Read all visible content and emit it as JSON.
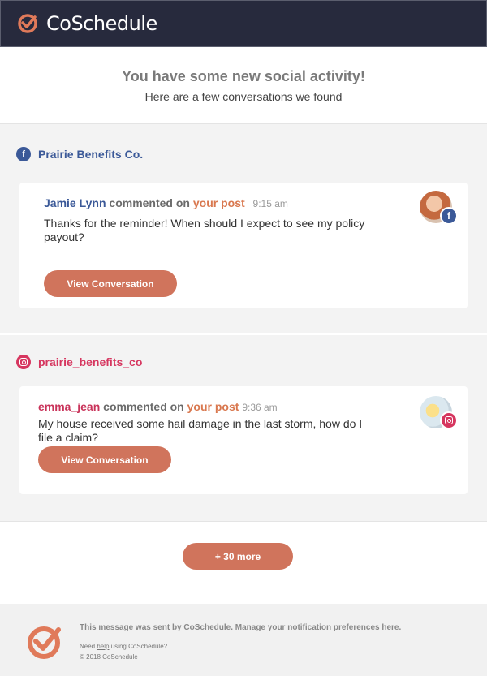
{
  "header": {
    "brand": "CoSchedule"
  },
  "intro": {
    "title": "You have some new social activity!",
    "subtitle": "Here are a few conversations we found"
  },
  "groups": [
    {
      "network": "facebook",
      "account": "Prairie Benefits Co.",
      "activity": {
        "user": "Jamie Lynn",
        "action": "commented on",
        "target": "your post",
        "time": "9:15 am",
        "comment": "Thanks for the reminder! When should I expect to see my policy payout?",
        "button": "View Conversation"
      }
    },
    {
      "network": "instagram",
      "account": "prairie_benefits_co",
      "activity": {
        "user": "emma_jean",
        "action": "commented on",
        "target": "your post",
        "time": "9:36 am",
        "comment": "My house received some hail damage in the last storm, how do I file a claim?",
        "button": "View Conversation"
      }
    }
  ],
  "more_button": "+ 30 more",
  "footer": {
    "sent_prefix": "This message was sent by",
    "sent_link": "CoSchedule",
    "manage_prefix": ". Manage your",
    "manage_link": "notification preferences",
    "manage_suffix": "here.",
    "help_prefix": "Need",
    "help_link": "help",
    "help_suffix": "using CoSchedule?",
    "copyright": "© 2018 CoSchedule"
  },
  "colors": {
    "header_bg": "#272a3d",
    "accent": "#d0745c",
    "facebook": "#3b5998",
    "instagram": "#d6365f"
  },
  "icons": [
    "coschedule-logo-icon",
    "facebook-icon",
    "instagram-icon"
  ]
}
